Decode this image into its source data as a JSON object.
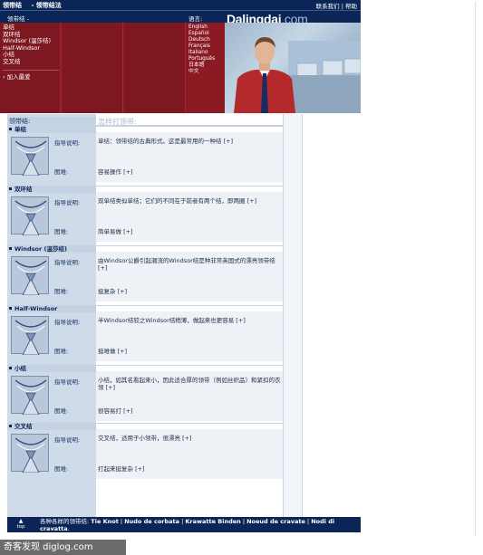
{
  "topbar": {
    "left": [
      "领带结",
      "- 领带结法"
    ],
    "right": [
      "联系我们",
      "|",
      "帮助"
    ]
  },
  "subbar": {
    "path": "领带结 -",
    "language_label": "语言:"
  },
  "logo": {
    "main": "Dalingdai",
    "suffix": ".com"
  },
  "nav": {
    "items": [
      "单结",
      "双环结",
      "Windsor (温莎结)",
      "Half-Windsor",
      "小结",
      "交叉结"
    ],
    "favorite": "加入最爱"
  },
  "languages": [
    "English",
    "Español",
    "Deutsch",
    "Français",
    "Italiano",
    "Português",
    "日本語",
    "中文"
  ],
  "content": {
    "knots_header": "领带结:",
    "howto_title": "怎样打领带:",
    "instructions_label": "指导说明:",
    "diagram_label": "图难:",
    "knots": [
      {
        "name": "单结",
        "instructions": "单结：领带结的古典形式。这是最常用的一种结 [+]",
        "diagram": "容易操作 [+]"
      },
      {
        "name": "双环结",
        "instructions": "双单结类似单结；它们的不同在于前者有两个结，即两圈 [+]",
        "diagram": "简单易做 [+]"
      },
      {
        "name": "Windsor (温莎结)",
        "instructions": "由Windsor公爵引起潮流的Windsor结是种非常英国式的漂亮领带结 [+]",
        "diagram": "挺复杂 [+]"
      },
      {
        "name": "Half-Windsor",
        "instructions": "半Windsor结较之Windsor结稍薄，做起来也更容易 [+]",
        "diagram": "挺难做 [+]"
      },
      {
        "name": "小结",
        "instructions": "小结，如其名看起来小，因此适合厚的领带（例如丝织品）和紧扣的衣领 [+]",
        "diagram": "很容易打 [+]"
      },
      {
        "name": "交叉结",
        "instructions": "交叉结，适用于小领带，很漂亮 [+]",
        "diagram": "打起来挺复杂 [+]"
      }
    ]
  },
  "footer": {
    "top_label": "top",
    "lead": "各种各样的领带结:",
    "links": [
      "Tie Knot",
      "Nudo de corbata",
      "Krawatte Binden",
      "Noeud de cravate",
      "Nodi di cravatta"
    ],
    "trail": "."
  },
  "watermark": "奇客发现 diglog.com",
  "colors": {
    "navy": "#0c2557",
    "crimson": "#8b1a22",
    "panel": "#d0dbe9"
  }
}
